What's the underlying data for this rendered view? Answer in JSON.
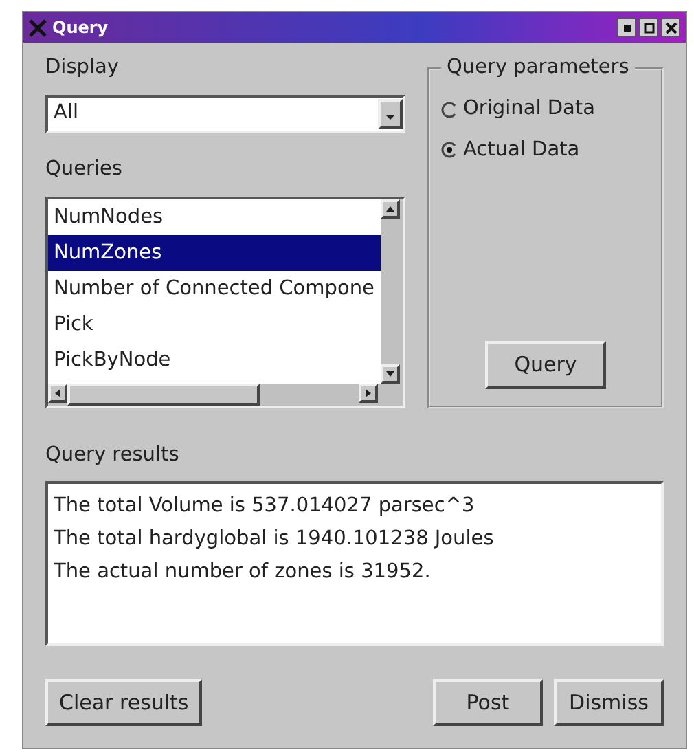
{
  "window": {
    "title": "Query"
  },
  "display": {
    "label": "Display",
    "value": "All"
  },
  "queries": {
    "label": "Queries",
    "items": [
      {
        "label": "NumNodes",
        "selected": false
      },
      {
        "label": "NumZones",
        "selected": true
      },
      {
        "label": "Number of Connected Compone",
        "selected": false
      },
      {
        "label": "Pick",
        "selected": false
      },
      {
        "label": "PickByNode",
        "selected": false
      }
    ]
  },
  "parameters": {
    "title": "Query parameters",
    "options": [
      {
        "label": "Original Data",
        "selected": false
      },
      {
        "label": "Actual Data",
        "selected": true
      }
    ],
    "button": "Query"
  },
  "results": {
    "label": "Query results",
    "lines": [
      "The total Volume is 537.014027 parsec^3",
      "The total hardyglobal is 1940.101238 Joules",
      "The actual number of zones is 31952."
    ]
  },
  "left_buttons": [
    "Clear results"
  ],
  "right_buttons": [
    "Post",
    "Dismiss"
  ]
}
